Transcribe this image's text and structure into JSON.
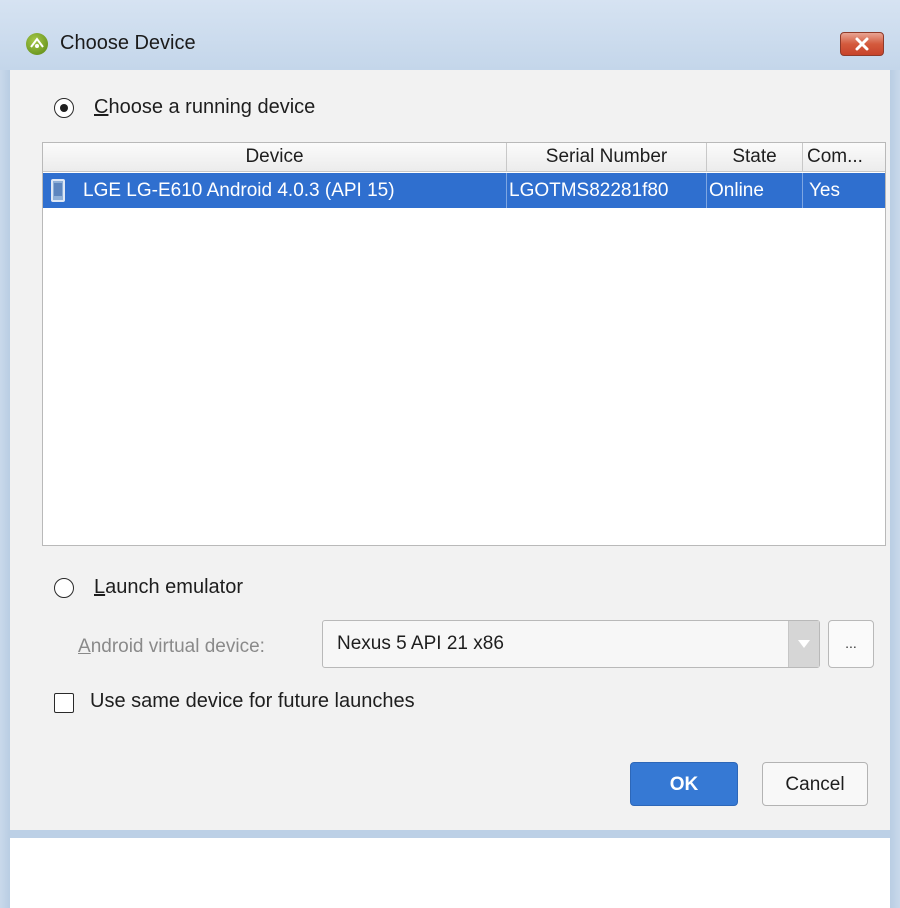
{
  "window": {
    "title": "Choose Device"
  },
  "running": {
    "label": "Choose a running device",
    "selected": true
  },
  "table": {
    "columns": [
      "Device",
      "Serial Number",
      "State",
      "Com..."
    ],
    "rows": [
      {
        "device": "LGE LG-E610 Android 4.0.3 (API 15)",
        "serial": "LGOTMS82281f80",
        "state": "Online",
        "compatible": "Yes",
        "icon": "phone-icon"
      }
    ]
  },
  "emulator": {
    "label": "Launch emulator",
    "selected": false,
    "avd_label": "Android virtual device:",
    "avd_value": "Nexus 5 API 21 x86",
    "more_label": "..."
  },
  "future": {
    "label": "Use same device for future launches",
    "checked": false
  },
  "buttons": {
    "ok": "OK",
    "cancel": "Cancel"
  },
  "colors": {
    "selection": "#2f6fcf",
    "ok_button": "#3679d4",
    "close_button": "#c7432a"
  }
}
